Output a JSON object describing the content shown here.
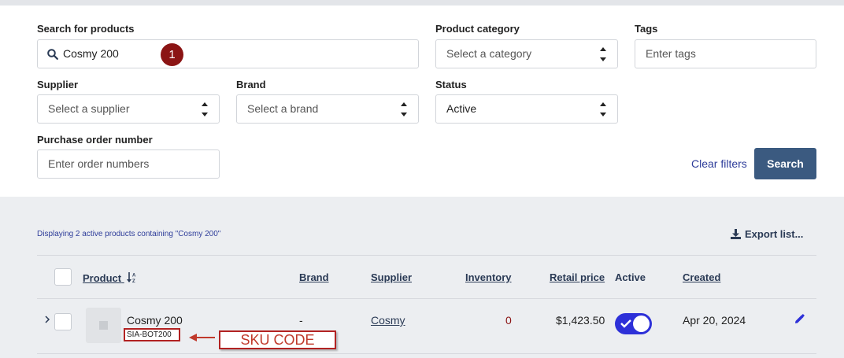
{
  "filters": {
    "search": {
      "label": "Search for products",
      "value": "Cosmy 200",
      "step_badge": "1"
    },
    "category": {
      "label": "Product category",
      "value": "Select a category"
    },
    "tags": {
      "label": "Tags",
      "placeholder": "Enter tags"
    },
    "supplier": {
      "label": "Supplier",
      "value": "Select a supplier"
    },
    "brand": {
      "label": "Brand",
      "value": "Select a brand"
    },
    "status": {
      "label": "Status",
      "value": "Active"
    },
    "po": {
      "label": "Purchase order number",
      "placeholder": "Enter order numbers"
    },
    "clear_label": "Clear filters",
    "search_label": "Search"
  },
  "results": {
    "summary": "Displaying 2 active products containing \"Cosmy 200\"",
    "export_label": "Export list...",
    "columns": {
      "product": "Product",
      "brand": "Brand",
      "supplier": "Supplier",
      "inventory": "Inventory",
      "retail": "Retail price",
      "active": "Active",
      "created": "Created"
    },
    "rows": [
      {
        "name": "Cosmy 200",
        "sku": "SIA-BOT200",
        "brand": "-",
        "supplier": "Cosmy",
        "inventory": "0",
        "retail": "$1,423.50",
        "active": true,
        "created": "Apr 20, 2024"
      }
    ]
  },
  "annotation": {
    "callout": "SKU CODE"
  },
  "colors": {
    "accent": "#2e3d9a",
    "button": "#3b5a80",
    "toggle": "#2d30d8",
    "annotation": "#b22222",
    "inventory_zero": "#8b1414"
  }
}
